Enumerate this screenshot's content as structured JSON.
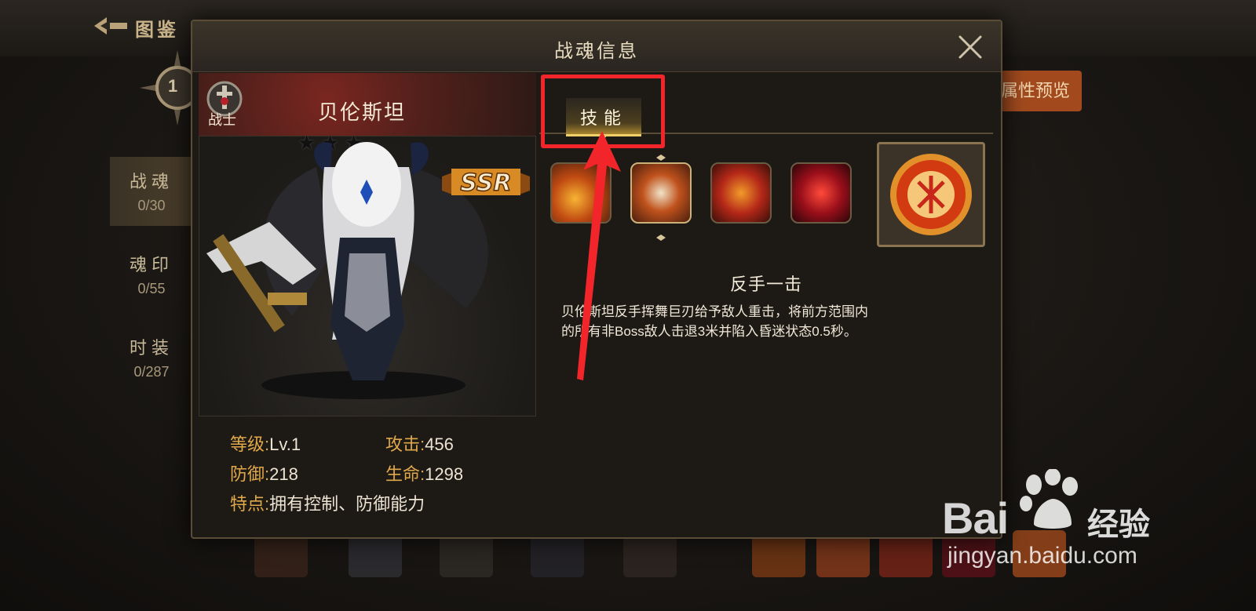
{
  "background": {
    "title": "图鉴",
    "level_badge": "1",
    "preview_button": "属性预览",
    "nav": [
      {
        "label": "战魂",
        "count": "0/30",
        "active": true
      },
      {
        "label": "魂印",
        "count": "0/55",
        "active": false
      },
      {
        "label": "时装",
        "count": "0/287",
        "active": false
      }
    ]
  },
  "dialog": {
    "title": "战魂信息",
    "hero": {
      "class_label": "战士",
      "name": "贝伦斯坦",
      "rarity": "SSR"
    },
    "stats": {
      "level_key": "等级:",
      "level_val": "Lv.1",
      "attack_key": "攻击:",
      "attack_val": "456",
      "defense_key": "防御:",
      "defense_val": "218",
      "hp_key": "生命:",
      "hp_val": "1298",
      "trait_key": "特点:",
      "trait_val": "拥有控制、防御能力"
    },
    "tab_label": "技能",
    "skill": {
      "name": "反手一击",
      "desc_line1": "贝伦斯坦反手挥舞巨刃给予敌人重击，将前方范围内",
      "desc_line2": "的所有非Boss敌人击退3米并陷入昏迷状态0.5秒。"
    }
  },
  "watermark": {
    "bai": "Bai",
    "du_text": "经验",
    "url": "jingyan.baidu.com"
  },
  "colors": {
    "accent_gold": "#e0a84a",
    "highlight_red": "#f2262a",
    "preview_orange": "#a24a1e"
  }
}
